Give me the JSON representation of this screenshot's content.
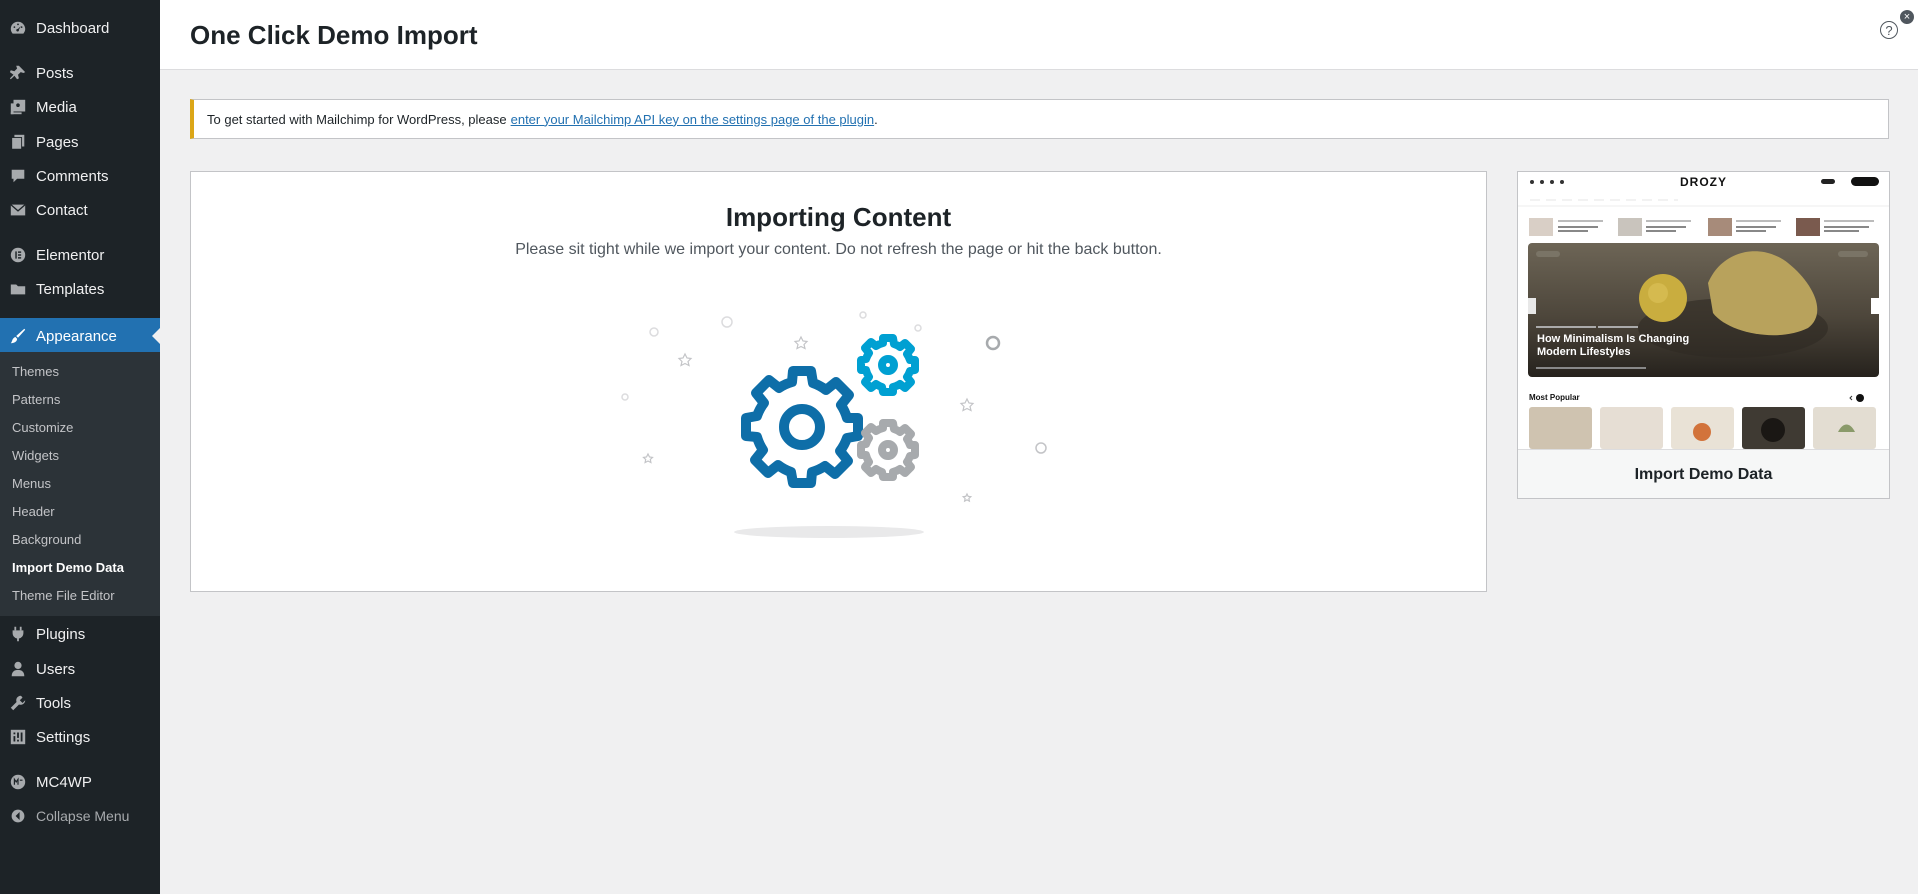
{
  "sidebar": {
    "items": [
      {
        "label": "Dashboard",
        "icon": "dashboard-icon"
      },
      {
        "label": "Posts",
        "icon": "pin-icon"
      },
      {
        "label": "Media",
        "icon": "media-icon"
      },
      {
        "label": "Pages",
        "icon": "pages-icon"
      },
      {
        "label": "Comments",
        "icon": "comment-icon"
      },
      {
        "label": "Contact",
        "icon": "mail-icon"
      },
      {
        "label": "Elementor",
        "icon": "elementor-icon"
      },
      {
        "label": "Templates",
        "icon": "folder-icon"
      },
      {
        "label": "Appearance",
        "icon": "brush-icon"
      },
      {
        "label": "Plugins",
        "icon": "plug-icon"
      },
      {
        "label": "Users",
        "icon": "user-icon"
      },
      {
        "label": "Tools",
        "icon": "wrench-icon"
      },
      {
        "label": "Settings",
        "icon": "sliders-icon"
      },
      {
        "label": "MC4WP",
        "icon": "mc4wp-icon"
      }
    ],
    "submenu": [
      "Themes",
      "Patterns",
      "Customize",
      "Widgets",
      "Menus",
      "Header",
      "Background",
      "Import Demo Data",
      "Theme File Editor"
    ],
    "collapse_label": "Collapse Menu"
  },
  "header": {
    "title": "One Click Demo Import",
    "help": "?",
    "close": "×"
  },
  "notice": {
    "text": "To get started with Mailchimp for WordPress, please",
    "link": "enter your Mailchimp API key on the settings page of the plugin",
    "after": "."
  },
  "import": {
    "title": "Importing Content",
    "description": "Please sit tight while we import your content. Do not refresh the page or hit the back button."
  },
  "demo": {
    "brand": "DROZY",
    "featured_title_line1": "How Minimalism Is Changing",
    "featured_title_line2": "Modern Lifestyles",
    "section_label": "Most Popular",
    "button_label": "Import Demo Data"
  },
  "colors": {
    "accent": "#2271b1",
    "gear_dark": "#0e6ea8",
    "gear_light": "#00a0d2",
    "gear_grey": "#a7aaad",
    "notice_border": "#dba617"
  }
}
